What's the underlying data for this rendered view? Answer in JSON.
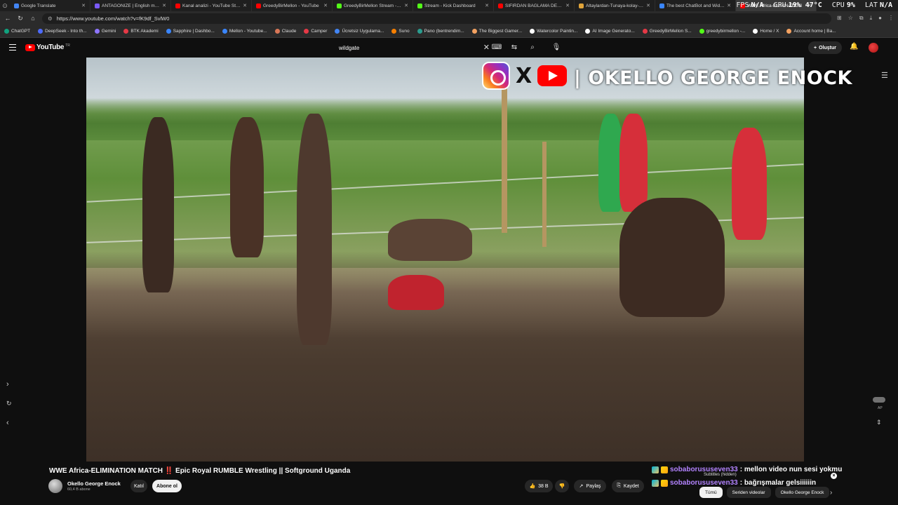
{
  "browser": {
    "tabs": [
      {
        "label": "Google Translate",
        "color": "#4285f4"
      },
      {
        "label": "ANTAGONIZE | English meaning",
        "color": "#7a5af8"
      },
      {
        "label": "Kanal analizi - YouTube Studio",
        "color": "#ff0000"
      },
      {
        "label": "GreedyBirMellon - YouTube",
        "color": "#ff0000"
      },
      {
        "label": "GreedyBirMellon Stream - Watch",
        "color": "#53fc18"
      },
      {
        "label": "Stream - Kick Dashboard",
        "color": "#53fc18"
      },
      {
        "label": "SIFIRDAN BAĞLAMA DERSLERİ",
        "color": "#ff0000"
      },
      {
        "label": "Altaylardan-Tunaya-kolay-nota",
        "color": "#e0a43a"
      },
      {
        "label": "The best ChatBot and Widgets",
        "color": "#3a86ff"
      },
      {
        "label": "WWE Africa-ELIMINATION",
        "color": "#ff0000"
      }
    ],
    "hud": {
      "fps_label": "FPS",
      "fps_value": "N/A",
      "gpu_label": "GPU",
      "gpu_value": "19% 47°C",
      "cpu_label": "CPU",
      "cpu_value": "9%",
      "lat_label": "LAT",
      "lat_value": "N/A"
    },
    "url": "https://www.youtube.com/watch?v=fK9df_SvlW0",
    "bookmarks": [
      {
        "label": "ChatGPT",
        "color": "#10a37f"
      },
      {
        "label": "DeepSeek - Into th...",
        "color": "#4d6bfe"
      },
      {
        "label": "Gemini",
        "color": "#8e75ff"
      },
      {
        "label": "BTK Akademi",
        "color": "#e63946"
      },
      {
        "label": "Sapphire | Dashbo...",
        "color": "#3a86ff"
      },
      {
        "label": "Mellon - Youtube...",
        "color": "#3a86ff"
      },
      {
        "label": "Claude",
        "color": "#d97757"
      },
      {
        "label": "Camper",
        "color": "#e63946"
      },
      {
        "label": "Ücretsiz Uygulama...",
        "color": "#4285f4"
      },
      {
        "label": "Suno",
        "color": "#f77f00"
      },
      {
        "label": "Pano (bentrendim...",
        "color": "#2a9d8f"
      },
      {
        "label": "The Biggest Gamer...",
        "color": "#f4a261"
      },
      {
        "label": "Watercolor Paintin...",
        "color": "#ffffff"
      },
      {
        "label": "AI Image Generato...",
        "color": "#ffffff"
      },
      {
        "label": "GreedyBirMellon S...",
        "color": "#e63946"
      },
      {
        "label": "greedybirmellon -...",
        "color": "#53fc18"
      },
      {
        "label": "Home / X",
        "color": "#ffffff"
      },
      {
        "label": "Account home | Ba...",
        "color": "#f4a261"
      }
    ]
  },
  "youtube": {
    "logo_text": "YouTube",
    "logo_region": "TR",
    "search_value": "wildgate",
    "create_label": "Oluştur",
    "video_overlay": {
      "channel_text": "| OKELLO GEORGE ENOCK",
      "x_glyph": "X"
    },
    "video": {
      "title": "WWE Africa-ELIMINATION MATCH ‼️ Epic Royal RUMBLE Wrestling || Softground Uganda",
      "channel": "Okello George Enock",
      "subscribers": "60,4 B abone",
      "join_label": "Katıl",
      "subscribe_label": "Abone ol",
      "likes": "38 B",
      "share_label": "Paylaş",
      "save_label": "Kaydet"
    },
    "side_label": "AP",
    "chat": [
      {
        "user": "sobaborususeven33",
        "message": ": mellon video nun sesi yokmu"
      },
      {
        "user": "sobaborususeven33",
        "message": ": bağrışmalar gelsiiiiiin"
      }
    ],
    "subtitle_hint": "Subtitles (hidden)",
    "chips": [
      {
        "label": "Tümü",
        "selected": true
      },
      {
        "label": "Seriden videolar",
        "selected": false
      },
      {
        "label": "Okello George Enock",
        "selected": false
      }
    ]
  }
}
